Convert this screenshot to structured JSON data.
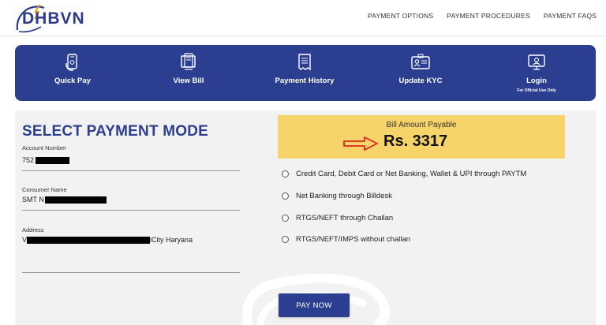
{
  "header": {
    "logo_text": "DHBVN",
    "nav": [
      "PAYMENT OPTIONS",
      "PAYMENT PROCEDURES",
      "PAYMENT FAQS"
    ]
  },
  "quick_actions": [
    {
      "label": "Quick Pay",
      "icon": "phone-pay-icon"
    },
    {
      "label": "View Bill",
      "icon": "view-bill-icon"
    },
    {
      "label": "Payment History",
      "icon": "receipt-icon"
    },
    {
      "label": "Update KYC",
      "icon": "id-card-icon"
    },
    {
      "label": "Login",
      "sublabel": "For Official Use Only",
      "icon": "login-icon"
    }
  ],
  "form": {
    "title": "SELECT PAYMENT MODE",
    "account_label": "Account Number",
    "account_value": "752",
    "consumer_label": "Consumer Name",
    "consumer_value": "SMT N",
    "address_label": "Address",
    "address_prefix": "V",
    "address_suffix": "iCity  Haryana"
  },
  "bill": {
    "title": "Bill Amount Payable",
    "amount": "Rs. 3317"
  },
  "payment_options": [
    "Credit Card, Debit Card or Net Banking, Wallet & UPI through PAYTM",
    "Net Banking through Billdesk",
    "RTGS/NEFT through Challan",
    "RTGS/NEFT/IMPS without challan"
  ],
  "pay_button": "PAY NOW",
  "colors": {
    "brand": "#2c3e8f",
    "amount_bg": "#f7d46a",
    "arrow": "#d9261c",
    "panel_bg": "#f2f2f2"
  }
}
